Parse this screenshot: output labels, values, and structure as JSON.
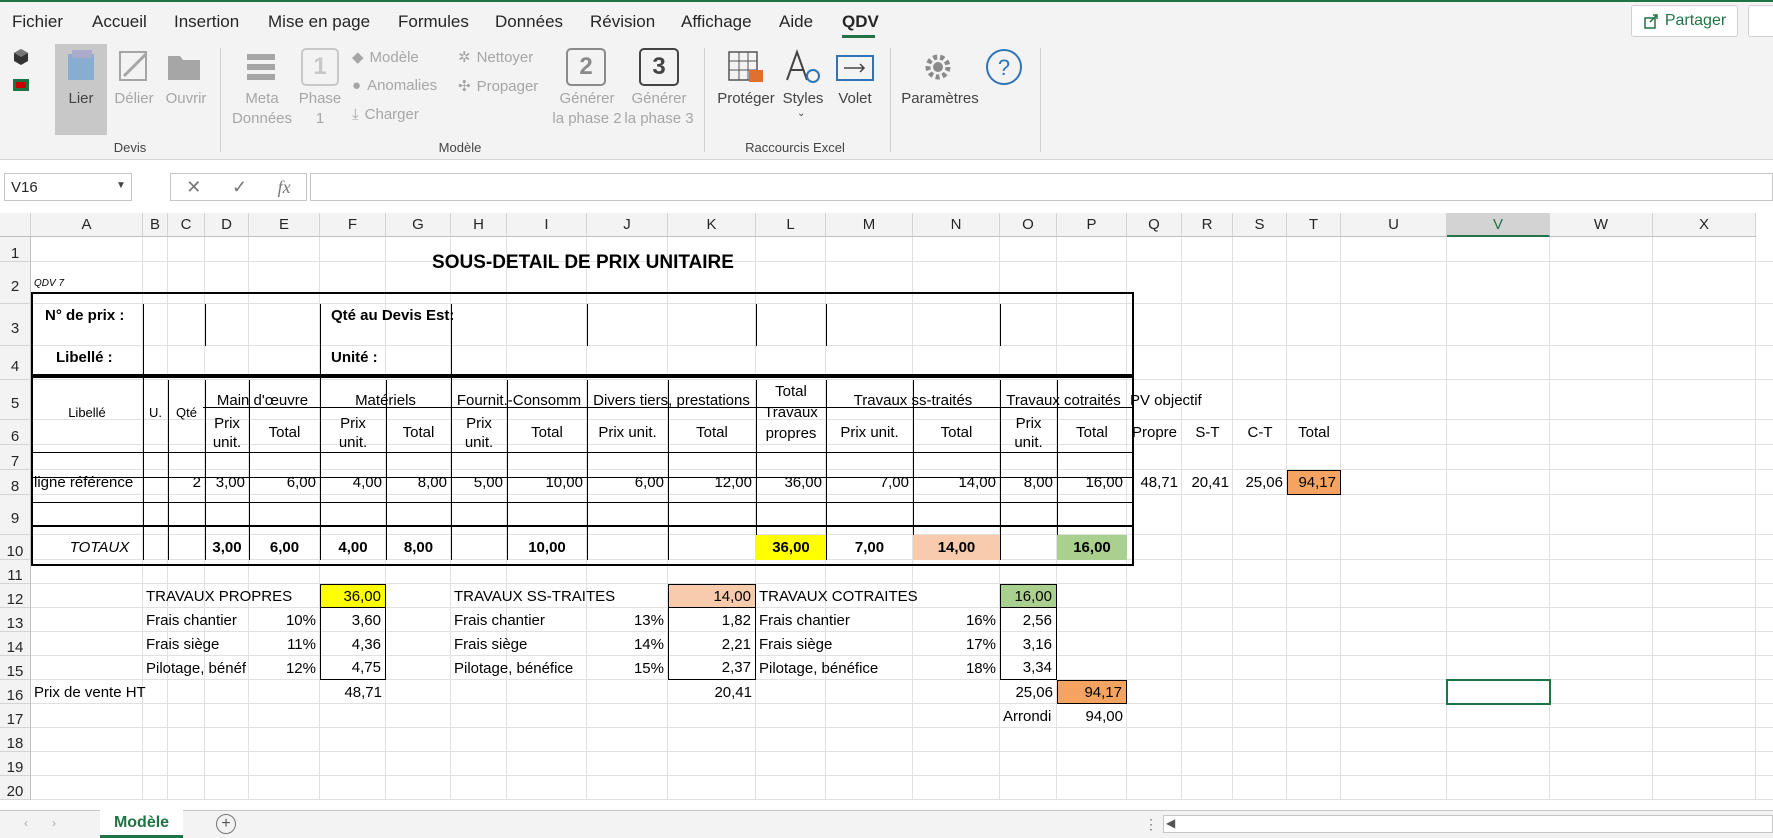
{
  "menu": {
    "items": [
      "Fichier",
      "Accueil",
      "Insertion",
      "Mise en page",
      "Formules",
      "Données",
      "Révision",
      "Affichage",
      "Aide",
      "QDV"
    ],
    "share": "Partager"
  },
  "ribbon": {
    "devis": {
      "lier": "Lier",
      "delier": "Délier",
      "ouvrir": "Ouvrir",
      "group": "Devis"
    },
    "modele": {
      "meta1": "Meta",
      "meta2": "Données",
      "phase1a": "Phase",
      "phase1b": "1",
      "phase_num1": "1",
      "modele": "Modèle",
      "anomalies": "Anomalies",
      "charger": "Charger",
      "nettoyer": "Nettoyer",
      "propager": "Propager",
      "gen2a": "Générer",
      "gen2b": "la phase 2",
      "phase_num2": "2",
      "gen3a": "Générer",
      "gen3b": "la phase 3",
      "phase_num3": "3",
      "group": "Modèle"
    },
    "raccourcis": {
      "proteger": "Protéger",
      "styles": "Styles",
      "volet": "Volet",
      "group": "Raccourcis Excel"
    },
    "parametres": {
      "label": "Paramètres"
    }
  },
  "formula": {
    "namebox": "V16",
    "fx": "fx",
    "value": ""
  },
  "columns": [
    "A",
    "B",
    "C",
    "D",
    "E",
    "F",
    "G",
    "H",
    "I",
    "J",
    "K",
    "L",
    "M",
    "N",
    "O",
    "P",
    "Q",
    "R",
    "S",
    "T",
    "U",
    "V",
    "W",
    "X"
  ],
  "rows": [
    "1",
    "2",
    "3",
    "4",
    "5",
    "6",
    "7",
    "8",
    "9",
    "10",
    "11",
    "12",
    "13",
    "14",
    "15",
    "16",
    "17",
    "18",
    "19",
    "20"
  ],
  "sheet": {
    "title": "SOUS-DETAIL DE PRIX UNITAIRE",
    "code": "QDV 7",
    "num_prix": "N° de prix :",
    "qte_devis": "Qté au Devis Est:",
    "libelle_lbl": "Libellé :",
    "unite_lbl": "Unité :",
    "h_libelle": "Libellé",
    "h_u": "U.",
    "h_qte": "Qté",
    "h_mo": "Main d'œuvre",
    "h_mat": "Matériels",
    "h_fourn": "Fournit.-Consomm",
    "h_divers": "Divers tiers, prestations",
    "h_total_tp1": "Total",
    "h_total_tp2": "Travaux",
    "h_total_tp3": "propres",
    "h_sst": "Travaux ss-traités",
    "h_cot": "Travaux cotraités",
    "h_pvobj": "PV objectif",
    "h_prix1": "Prix",
    "h_prix2": "unit.",
    "h_total": "Total",
    "h_prixunit": "Prix unit.",
    "h_propre": "Propre",
    "h_st": "S-T",
    "h_ct": "C-T",
    "row8": {
      "lib": "ligne référence",
      "qte": "2",
      "d": "3,00",
      "e": "6,00",
      "f": "4,00",
      "g": "8,00",
      "h": "5,00",
      "i": "10,00",
      "j": "6,00",
      "k": "12,00",
      "l": "36,00",
      "m": "7,00",
      "n": "14,00",
      "o": "8,00",
      "p": "16,00",
      "q": "48,71",
      "r": "20,41",
      "s": "25,06",
      "t": "94,17"
    },
    "row10": {
      "lib": "TOTAUX",
      "d": "3,00",
      "e": "6,00",
      "f": "4,00",
      "g": "8,00",
      "i": "10,00",
      "l": "36,00",
      "m": "7,00",
      "n": "14,00",
      "p": "16,00"
    },
    "tp": {
      "label": "TRAVAUX PROPRES",
      "total": "36,00",
      "fc": "Frais chantier",
      "fc_p": "10%",
      "fc_v": "3,60",
      "fs": "Frais siège",
      "fs_p": "11%",
      "fs_v": "4,36",
      "pb": "Pilotage, bénéf",
      "pb_p": "12%",
      "pb_v": "4,75",
      "pv": "48,71"
    },
    "st": {
      "label": "TRAVAUX SS-TRAITES",
      "total": "14,00",
      "fc": "Frais chantier",
      "fc_p": "13%",
      "fc_v": "1,82",
      "fs": "Frais siège",
      "fs_p": "14%",
      "fs_v": "2,21",
      "pb": "Pilotage, bénéfice",
      "pb_p": "15%",
      "pb_v": "2,37",
      "pv": "20,41"
    },
    "ct": {
      "label": "TRAVAUX COTRAITES",
      "total": "16,00",
      "fc": "Frais chantier",
      "fc_p": "16%",
      "fc_v": "2,56",
      "fs": "Frais siège",
      "fs_p": "17%",
      "fs_v": "3,16",
      "pb": "Pilotage, bénéfice",
      "pb_p": "18%",
      "pb_v": "3,34",
      "pv": "25,06"
    },
    "pv_label": "Prix de vente HT",
    "pv_total": "94,17",
    "arrondi": "Arrondi",
    "arrondi_v": "94,00"
  },
  "tabs": {
    "active": "Modèle"
  },
  "colors": {
    "accent": "#217346",
    "yellow": "#ffff00",
    "salmon": "#f8cbad",
    "green": "#a9d08e",
    "orange": "#f4b183",
    "orange_dark": "#f4a460"
  }
}
